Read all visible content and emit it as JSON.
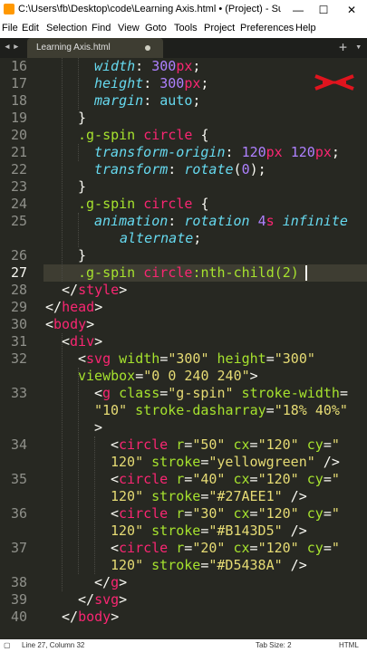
{
  "window": {
    "title": "C:\\Users\\fb\\Desktop\\code\\Learning Axis.html • (Project) - Su...",
    "minimize": "—",
    "maximize": "☐",
    "close": "✕"
  },
  "menu": [
    "File",
    "Edit",
    "Selection",
    "Find",
    "View",
    "Goto",
    "Tools",
    "Project",
    "Preferences",
    "Help"
  ],
  "tab": {
    "arrows": "◂▸",
    "label": "Learning Axis.html",
    "plus": "+",
    "dropdown": "▾"
  },
  "line_numbers": [
    "16",
    "17",
    "18",
    "19",
    "20",
    "21",
    "22",
    "23",
    "24",
    "25",
    "",
    "26",
    "27",
    "28",
    "29",
    "30",
    "31",
    "32",
    "",
    "33",
    "",
    "",
    "34",
    "",
    "35",
    "",
    "36",
    "",
    "37",
    "",
    "38",
    "39",
    "40"
  ],
  "code": {
    "l16": {
      "prop": "width",
      "colon": ": ",
      "val": "300",
      "unit": "px",
      "semi": ";"
    },
    "l17": {
      "prop": "height",
      "colon": ": ",
      "val": "300",
      "unit": "px",
      "semi": ";"
    },
    "l18": {
      "prop": "margin",
      "colon": ": ",
      "val": "auto",
      "semi": ";"
    },
    "l19": "}",
    "l20": {
      "sel": ".g-spin ",
      "tag": "circle",
      "brace": " {"
    },
    "l21": {
      "prop": "transform-origin",
      "colon": ": ",
      "v1": "120",
      "u1": "px",
      "sp": " ",
      "v2": "120",
      "u2": "px",
      "semi": ";"
    },
    "l22": {
      "prop": "transform",
      "colon": ": ",
      "fn": "rotate",
      "open": "(",
      "num": "0",
      "close": ");"
    },
    "l23": "}",
    "l24": {
      "sel": ".g-spin ",
      "tag": "circle",
      "brace": " {"
    },
    "l25": {
      "prop": "animation",
      "colon": ": ",
      "name": "rotation ",
      "num": "4",
      "unit": "s",
      "kw1": " infinite"
    },
    "l25b": {
      "kw2": "alternate",
      "semi": ";"
    },
    "l26": "}",
    "l27": {
      "sel": ".g-spin ",
      "tag": "circle",
      "pseudo": ":nth-child(2)"
    },
    "l28": {
      "open": "</",
      "tag": "style",
      "close": ">"
    },
    "l29": {
      "open": "</",
      "tag": "head",
      "close": ">"
    },
    "l30": {
      "open": "<",
      "tag": "body",
      "close": ">"
    },
    "l31": {
      "open": "<",
      "tag": "div",
      "close": ">"
    },
    "l32": {
      "open": "<",
      "tag": "svg",
      "a1": " width",
      "eq1": "=",
      "s1": "\"300\"",
      "a2": " height",
      "eq2": "=",
      "s2": "\"300\""
    },
    "l32b": {
      "a3": "viewbox",
      "eq3": "=",
      "s3": "\"0 0 240 240\"",
      "close": ">"
    },
    "l33": {
      "open": "<",
      "tag": "g",
      "a1": " class",
      "eq1": "=",
      "s1": "\"g-spin\"",
      "a2": " stroke-width",
      "eq2": "="
    },
    "l33b": {
      "s2": "\"10\"",
      "a3": " stroke-dasharray",
      "eq3": "=",
      "s3": "\"18% 40%\""
    },
    "l33c": ">",
    "c34": {
      "open": "<",
      "tag": "circle",
      "a1": " r",
      "eq1": "=",
      "s1": "\"50\"",
      "a2": " cx",
      "eq2": "=",
      "s2": "\"120\"",
      "a3": " cy",
      "eq3": "=",
      "s3": "\""
    },
    "c34b": {
      "s3": "120\"",
      "a4": " stroke",
      "eq4": "=",
      "s4": "\"yellowgreen\"",
      "close": " />"
    },
    "c35": {
      "open": "<",
      "tag": "circle",
      "a1": " r",
      "eq1": "=",
      "s1": "\"40\"",
      "a2": " cx",
      "eq2": "=",
      "s2": "\"120\"",
      "a3": " cy",
      "eq3": "=",
      "s3": "\""
    },
    "c35b": {
      "s3": "120\"",
      "a4": " stroke",
      "eq4": "=",
      "s4": "\"#27AEE1\"",
      "close": " />"
    },
    "c36": {
      "open": "<",
      "tag": "circle",
      "a1": " r",
      "eq1": "=",
      "s1": "\"30\"",
      "a2": " cx",
      "eq2": "=",
      "s2": "\"120\"",
      "a3": " cy",
      "eq3": "=",
      "s3": "\""
    },
    "c36b": {
      "s3": "120\"",
      "a4": " stroke",
      "eq4": "=",
      "s4": "\"#B143D5\"",
      "close": " />"
    },
    "c37": {
      "open": "<",
      "tag": "circle",
      "a1": " r",
      "eq1": "=",
      "s1": "\"20\"",
      "a2": " cx",
      "eq2": "=",
      "s2": "\"120\"",
      "a3": " cy",
      "eq3": "=",
      "s3": "\""
    },
    "c37b": {
      "s3": "120\"",
      "a4": " stroke",
      "eq4": "=",
      "s4": "\"#D5438A\"",
      "close": " />"
    },
    "l38": {
      "open": "</",
      "tag": "g",
      "close": ">"
    },
    "l39": {
      "open": "</",
      "tag": "svg",
      "close": ">"
    },
    "l40": {
      "open": "</",
      "tag": "body",
      "close": ">"
    }
  },
  "status": {
    "position": "Line 27, Column 32",
    "tab_size": "Tab Size: 2",
    "syntax": "HTML"
  },
  "colors": {
    "background": "#272822",
    "tag": "#f92672",
    "attribute": "#a6e22e",
    "string": "#e6db74",
    "number": "#ae81ff",
    "property": "#66d9ef"
  }
}
